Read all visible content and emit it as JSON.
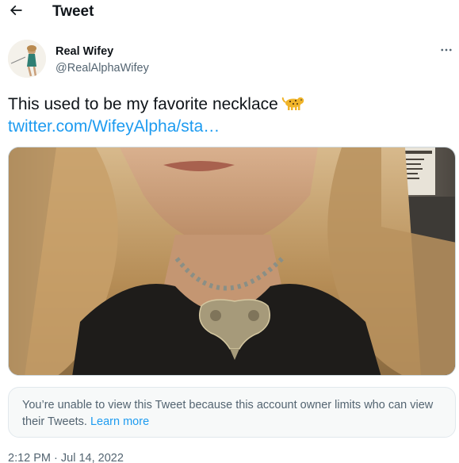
{
  "header": {
    "title": "Tweet",
    "back_icon": "arrow-left-icon"
  },
  "author": {
    "name": "Real Wifey",
    "handle": "@RealAlphaWifey",
    "more_icon": "more-horizontal-icon"
  },
  "tweet": {
    "text": "This used to be my favorite necklace",
    "emoji_icon": "leopard-emoji-icon",
    "link": "twitter.com/WifeyAlpha/sta…"
  },
  "notice": {
    "text": "You’re unable to view this Tweet because this account owner limits who can view their Tweets.",
    "link_label": "Learn more"
  },
  "timestamp": {
    "text": "2:12 PM · Jul 14, 2022"
  },
  "colors": {
    "link": "#1d9bf0",
    "secondary_text": "#536471",
    "primary_text": "#0f1419",
    "notice_bg": "#f7f9f9"
  }
}
